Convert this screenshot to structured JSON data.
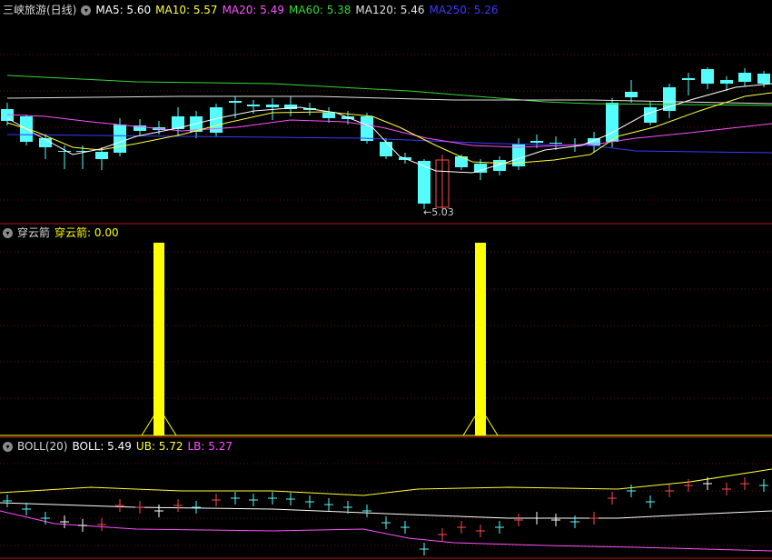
{
  "colors": {
    "up": "#ff4a4a",
    "down": "#54fcfc",
    "frame": "#b0171d",
    "grid": "#6e0c10"
  },
  "main": {
    "title": "三峡旅游(日线)",
    "indicators": [
      {
        "label": "MA5: 5.60",
        "color": "#ffffff"
      },
      {
        "label": "MA10: 5.57",
        "color": "#ffff3c"
      },
      {
        "label": "MA20: 5.49",
        "color": "#ff4fff"
      },
      {
        "label": "MA60: 5.38",
        "color": "#35d835"
      },
      {
        "label": "MA120: 5.46",
        "color": "#e0e0e0"
      },
      {
        "label": "MA250: 5.26",
        "color": "#3a3aff"
      }
    ],
    "low_label": "5.03"
  },
  "signal": {
    "title": "穿云箭",
    "value_label": "穿云箭: 0.00",
    "value_color": "#ffff00",
    "bar_color": "#ffff00"
  },
  "boll": {
    "title": "BOLL(20)",
    "indicators": [
      {
        "label": "BOLL: 5.49",
        "color": "#ffffff"
      },
      {
        "label": "UB: 5.72",
        "color": "#ffff3c"
      },
      {
        "label": "LB: 5.27",
        "color": "#ff4fff"
      }
    ]
  }
}
